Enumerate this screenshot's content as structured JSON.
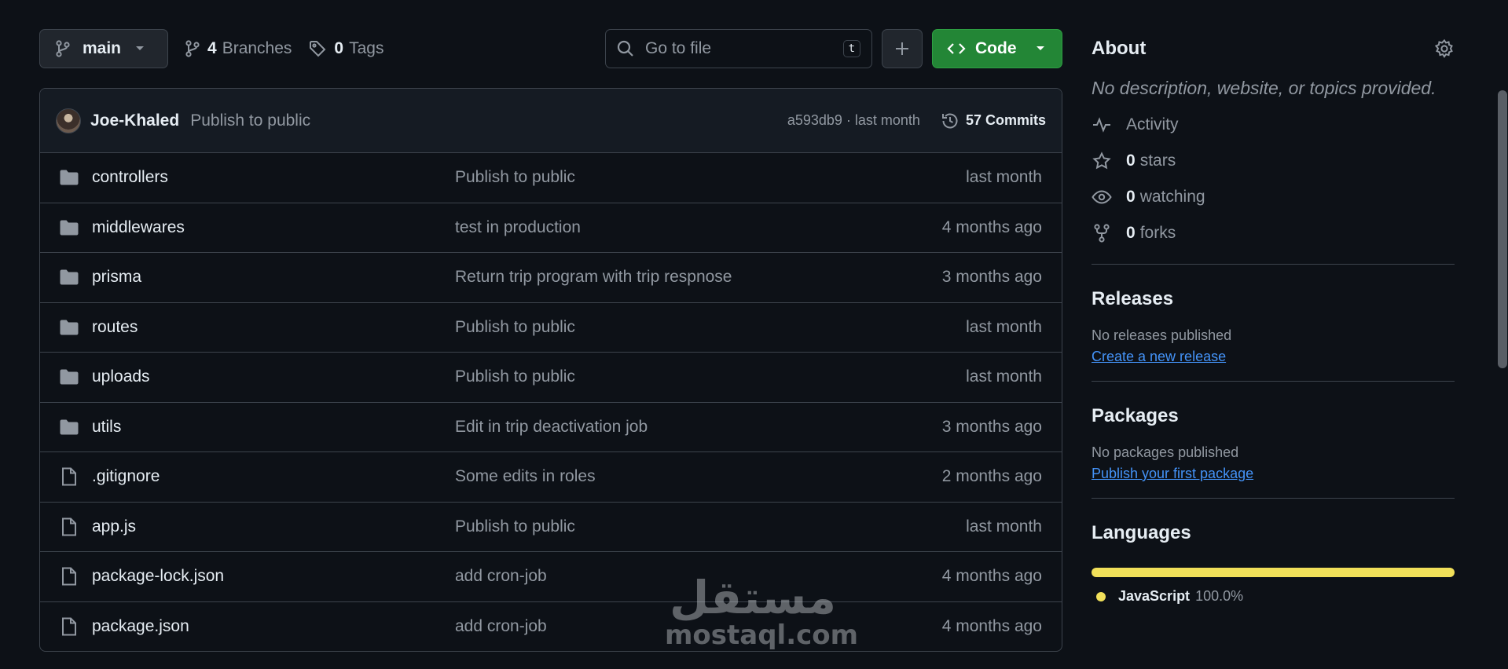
{
  "toolbar": {
    "branch": "main",
    "branches_count": "4",
    "branches_label": "Branches",
    "tags_count": "0",
    "tags_label": "Tags",
    "search_placeholder": "Go to file",
    "search_shortcut": "t",
    "code_label": "Code"
  },
  "commit": {
    "author": "Joe-Khaled",
    "message": "Publish to public",
    "sha_time": "a593db9 · last month",
    "commits_label": "57 Commits"
  },
  "files": [
    {
      "name": "controllers",
      "type": "folder",
      "message": "Publish to public",
      "date": "last month"
    },
    {
      "name": "middlewares",
      "type": "folder",
      "message": "test in production",
      "date": "4 months ago"
    },
    {
      "name": "prisma",
      "type": "folder",
      "message": "Return trip program with trip respnose",
      "date": "3 months ago"
    },
    {
      "name": "routes",
      "type": "folder",
      "message": "Publish to public",
      "date": "last month"
    },
    {
      "name": "uploads",
      "type": "folder",
      "message": "Publish to public",
      "date": "last month"
    },
    {
      "name": "utils",
      "type": "folder",
      "message": "Edit in trip deactivation job",
      "date": "3 months ago"
    },
    {
      "name": ".gitignore",
      "type": "file",
      "message": "Some edits in roles",
      "date": "2 months ago"
    },
    {
      "name": "app.js",
      "type": "file",
      "message": "Publish to public",
      "date": "last month"
    },
    {
      "name": "package-lock.json",
      "type": "file",
      "message": "add cron-job",
      "date": "4 months ago"
    },
    {
      "name": "package.json",
      "type": "file",
      "message": "add cron-job",
      "date": "4 months ago"
    }
  ],
  "about": {
    "title": "About",
    "description": "No description, website, or topics provided.",
    "activity_label": "Activity",
    "stars_count": "0",
    "stars_label": "stars",
    "watching_count": "0",
    "watching_label": "watching",
    "forks_count": "0",
    "forks_label": "forks"
  },
  "releases": {
    "title": "Releases",
    "empty_text": "No releases published",
    "link": "Create a new release"
  },
  "packages": {
    "title": "Packages",
    "empty_text": "No packages published",
    "link": "Publish your first package"
  },
  "languages": {
    "title": "Languages",
    "items": [
      {
        "name": "JavaScript",
        "percent": "100.0%",
        "color": "#f1e05a"
      }
    ]
  },
  "watermark": {
    "arabic": "مستقل",
    "latin": "mostaql.com"
  },
  "colors": {
    "background": "#0d1117",
    "border": "#3d444d",
    "code_button": "#238636",
    "link": "#4493f8",
    "muted_text": "#9198a1"
  }
}
